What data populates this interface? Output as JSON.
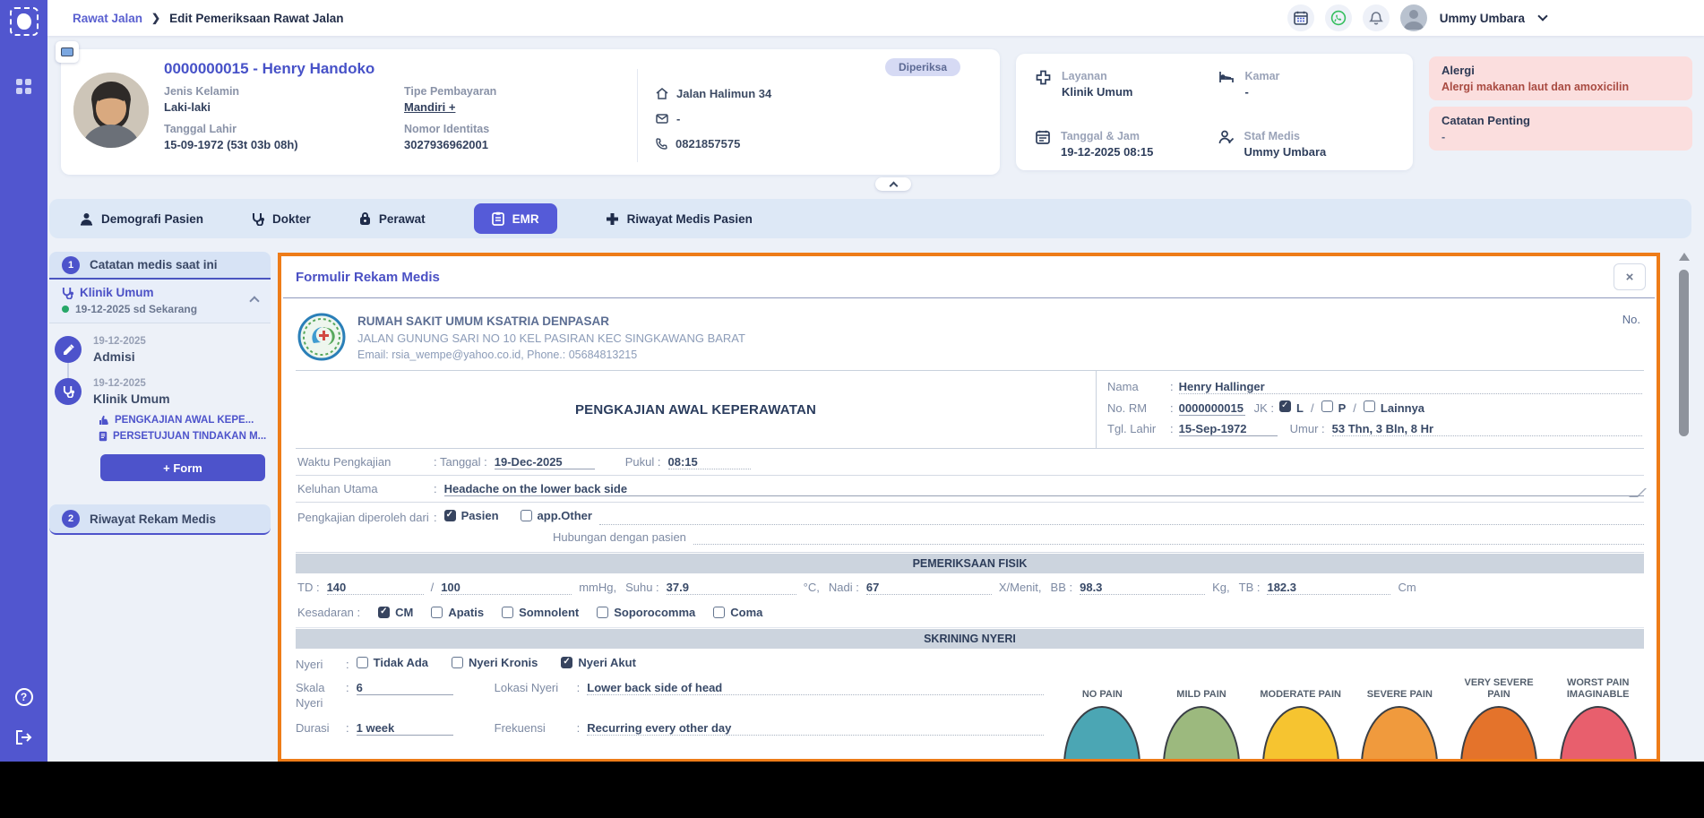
{
  "topbar": {
    "breadcrumb_parent": "Rawat Jalan",
    "breadcrumb_sep": "❯",
    "breadcrumb_current": "Edit Pemeriksaan Rawat Jalan",
    "user_name": "Ummy Umbara"
  },
  "patient_card": {
    "title": "0000000015 - Henry Handoko",
    "jenis_kelamin_label": "Jenis Kelamin",
    "jenis_kelamin": "Laki-laki",
    "tipe_pembayaran_label": "Tipe Pembayaran",
    "tipe_pembayaran": "Mandiri +",
    "tanggal_lahir_label": "Tanggal Lahir",
    "tanggal_lahir": "15-09-1972 (53t 03b 08h)",
    "nomor_identitas_label": "Nomor Identitas",
    "nomor_identitas": "3027936962001",
    "address": "Jalan Halimun 34",
    "email": "-",
    "phone": "0821857575",
    "status_badge": "Diperiksa"
  },
  "visit_card": {
    "layanan_label": "Layanan",
    "layanan_value": "Klinik Umum",
    "kamar_label": "Kamar",
    "kamar_value": "-",
    "tanggal_label": "Tanggal & Jam",
    "tanggal_value": "19-12-2025 08:15",
    "staf_label": "Staf Medis",
    "staf_value": "Ummy Umbara"
  },
  "alerts": {
    "alergi_title": "Alergi",
    "alergi_text": "Alergi makanan laut dan amoxicilin",
    "catatan_title": "Catatan Penting",
    "catatan_text": "-"
  },
  "tabs": [
    {
      "label": "Demografi Pasien",
      "active": false
    },
    {
      "label": "Dokter",
      "active": false
    },
    {
      "label": "Perawat",
      "active": false
    },
    {
      "label": "EMR",
      "active": true
    },
    {
      "label": "Riwayat Medis Pasien",
      "active": false
    }
  ],
  "sidebar": {
    "section1_number": "1",
    "section1_title": "Catatan medis saat ini",
    "current_clinic": "Klinik Umum",
    "current_period": "19-12-2025 sd Sekarang",
    "timeline": [
      {
        "date": "19-12-2025",
        "title": "Admisi"
      },
      {
        "date": "19-12-2025",
        "title": "Klinik Umum"
      }
    ],
    "documents": [
      "PENGKAJIAN AWAL KEPE...",
      "PERSETUJUAN TINDAKAN M..."
    ],
    "form_button": "+ Form",
    "section2_number": "2",
    "section2_title": "Riwayat Rekam Medis"
  },
  "form": {
    "title": "Formulir Rekam Medis",
    "close_label": "×",
    "colon": ":",
    "hospital": {
      "name": "RUMAH SAKIT UMUM KSATRIA DENPASAR",
      "address": "JALAN GUNUNG SARI NO 10 KEL PASIRAN KEC SINGKAWANG BARAT",
      "contact": "Email: rsia_wempe@yahoo.co.id, Phone.: 05684813215"
    },
    "no_label": "No.",
    "patient": {
      "nama_label": "Nama",
      "nama": "Henry Hallinger",
      "no_rm_label": "No. RM",
      "no_rm": "0000000015",
      "jk_label": "JK :",
      "jk_separator": "/",
      "jk_options": [
        {
          "label": "L",
          "checked": true
        },
        {
          "label": "P",
          "checked": false
        },
        {
          "label": "Lainnya",
          "checked": false
        }
      ],
      "tgl_lahir_label": "Tgl. Lahir",
      "tgl_lahir": "15-Sep-1972",
      "umur_label": "Umur :",
      "umur": "53 Thn, 3 Bln, 8 Hr"
    },
    "doc_title": "PENGKAJIAN AWAL KEPERAWATAN",
    "waktu": {
      "label": "Waktu Pengkajian",
      "tanggal_label": ": Tanggal :",
      "tanggal": "19-Dec-2025",
      "pukul_label": "Pukul :",
      "pukul": "08:15"
    },
    "keluhan": {
      "label": "Keluhan Utama",
      "value": "Headache on the lower back side"
    },
    "sumber": {
      "label": "Pengkajian diperoleh dari",
      "options": [
        {
          "label": "Pasien",
          "checked": true
        },
        {
          "label": "app.Other",
          "checked": false
        }
      ],
      "hubungan_label": "Hubungan dengan pasien"
    },
    "fisik": {
      "section_title": "PEMERIKSAAN FISIK",
      "td_label": "TD :",
      "td_sys": "140",
      "slash": "/",
      "td_dia": "100",
      "unit1": "mmHg,",
      "suhu_label": "Suhu :",
      "suhu": "37.9",
      "unit2": "°C,",
      "nadi_label": "Nadi :",
      "nadi": "67",
      "unit3": "X/Menit,",
      "bb_label": "BB :",
      "bb": "98.3",
      "unit4": "Kg,",
      "tb_label": "TB :",
      "tb": "182.3",
      "unit5": "Cm",
      "kesadaran_label": "Kesadaran :",
      "kesadaran_options": [
        {
          "label": "CM",
          "checked": true
        },
        {
          "label": "Apatis",
          "checked": false
        },
        {
          "label": "Somnolent",
          "checked": false
        },
        {
          "label": "Soporocomma",
          "checked": false
        },
        {
          "label": "Coma",
          "checked": false
        }
      ]
    },
    "nyeri": {
      "section_title": "SKRINING NYERI",
      "nyeri_label": "Nyeri",
      "options": [
        {
          "label": "Tidak Ada",
          "checked": false
        },
        {
          "label": "Nyeri Kronis",
          "checked": false
        },
        {
          "label": "Nyeri Akut",
          "checked": true
        }
      ],
      "skala_label": "Skala Nyeri",
      "skala": "6",
      "lokasi_label": "Lokasi Nyeri",
      "lokasi": "Lower back side of head",
      "durasi_label": "Durasi",
      "durasi": "1 week",
      "frekuensi_label": "Frekuensi",
      "frekuensi": "Recurring every other day",
      "pain_scale": [
        {
          "label": "NO PAIN",
          "color": "#4ba6b4"
        },
        {
          "label": "MILD PAIN",
          "color": "#9cb97e"
        },
        {
          "label": "MODERATE PAIN",
          "color": "#f6c430"
        },
        {
          "label": "SEVERE PAIN",
          "color": "#f09a3d"
        },
        {
          "label": "VERY SEVERE PAIN",
          "color": "#e4732b"
        },
        {
          "label": "WORST PAIN IMAGINABLE",
          "color": "#e85f6d"
        }
      ]
    }
  }
}
